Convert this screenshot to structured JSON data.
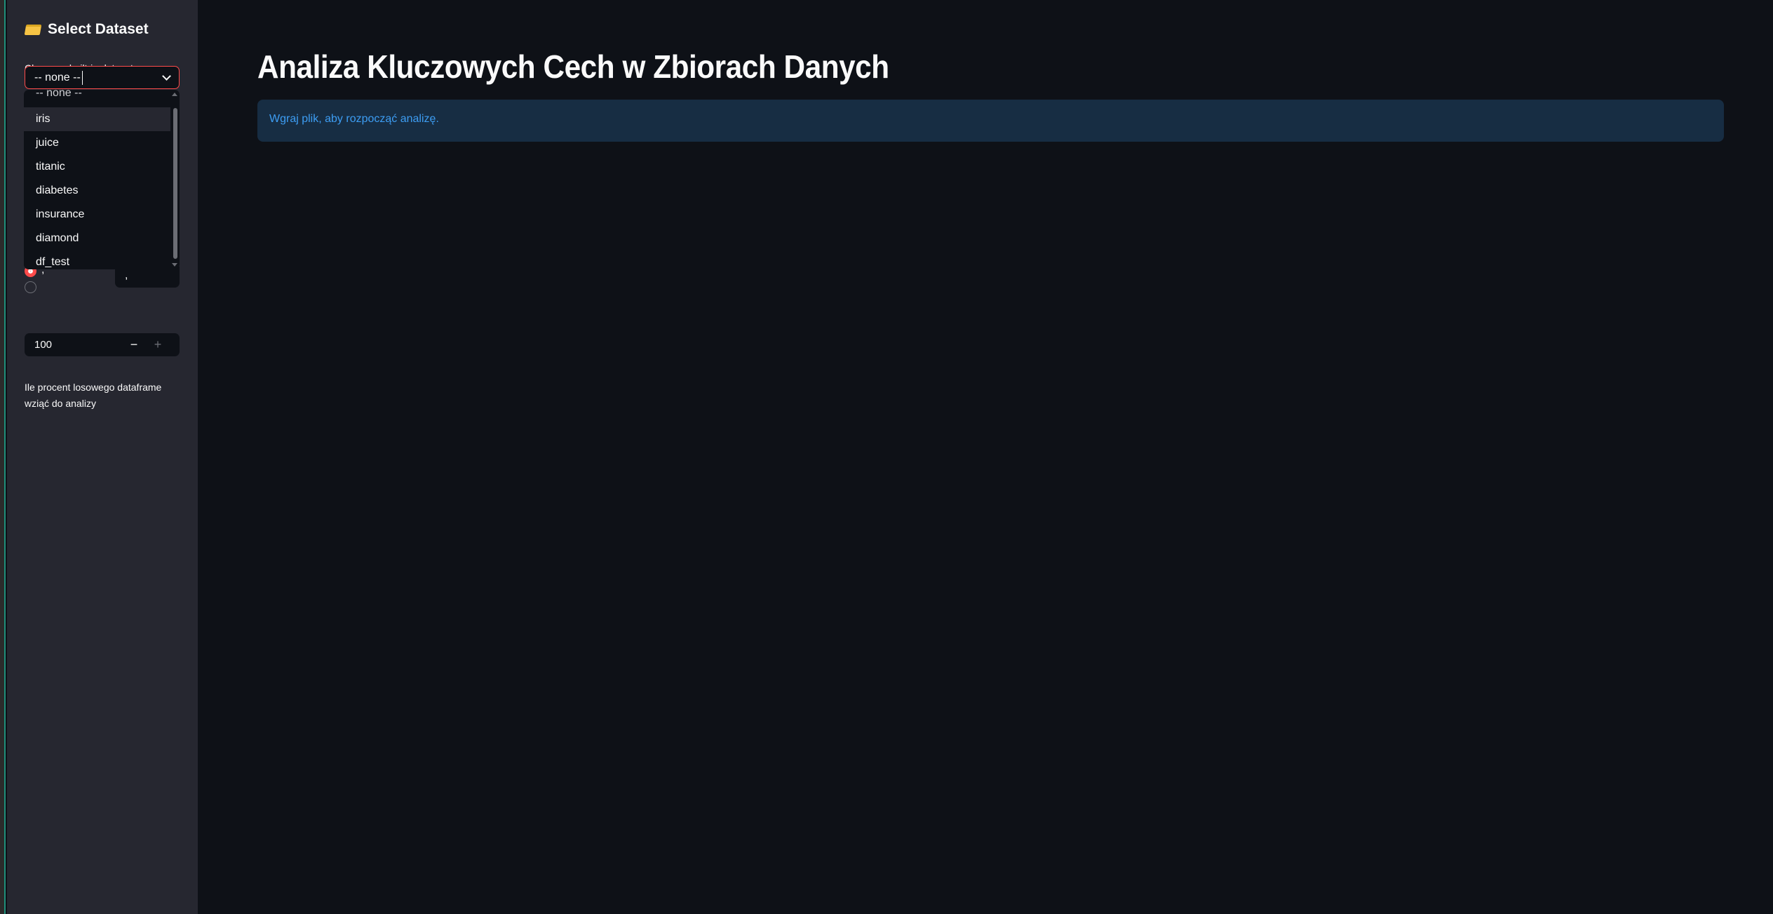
{
  "sidebar": {
    "title": "Select Dataset",
    "title_icon": "folder-icon",
    "dataset_label": "Choose a built-in dataset",
    "dataset_value": "-- none --",
    "dataset_options": [
      "-- none --",
      "iris",
      "juice",
      "titanic",
      "diabetes",
      "insurance",
      "diamond",
      "df_test"
    ],
    "separator_radio_label": ",",
    "separator_input_value": ",",
    "percent_label_line1": "Ile procent losowego dataframe",
    "percent_label_line2": "wziąć do analizy",
    "percent_value": "100",
    "minus": "−",
    "plus": "+"
  },
  "main": {
    "title": "Analiza Kluczowych Cech w Zbiorach Danych",
    "info": "Wgraj plik, aby rozpocząć analizę."
  },
  "colors": {
    "accent": "#ff4b4b",
    "info_bg": "#172d43",
    "info_text": "#3d9df3"
  }
}
